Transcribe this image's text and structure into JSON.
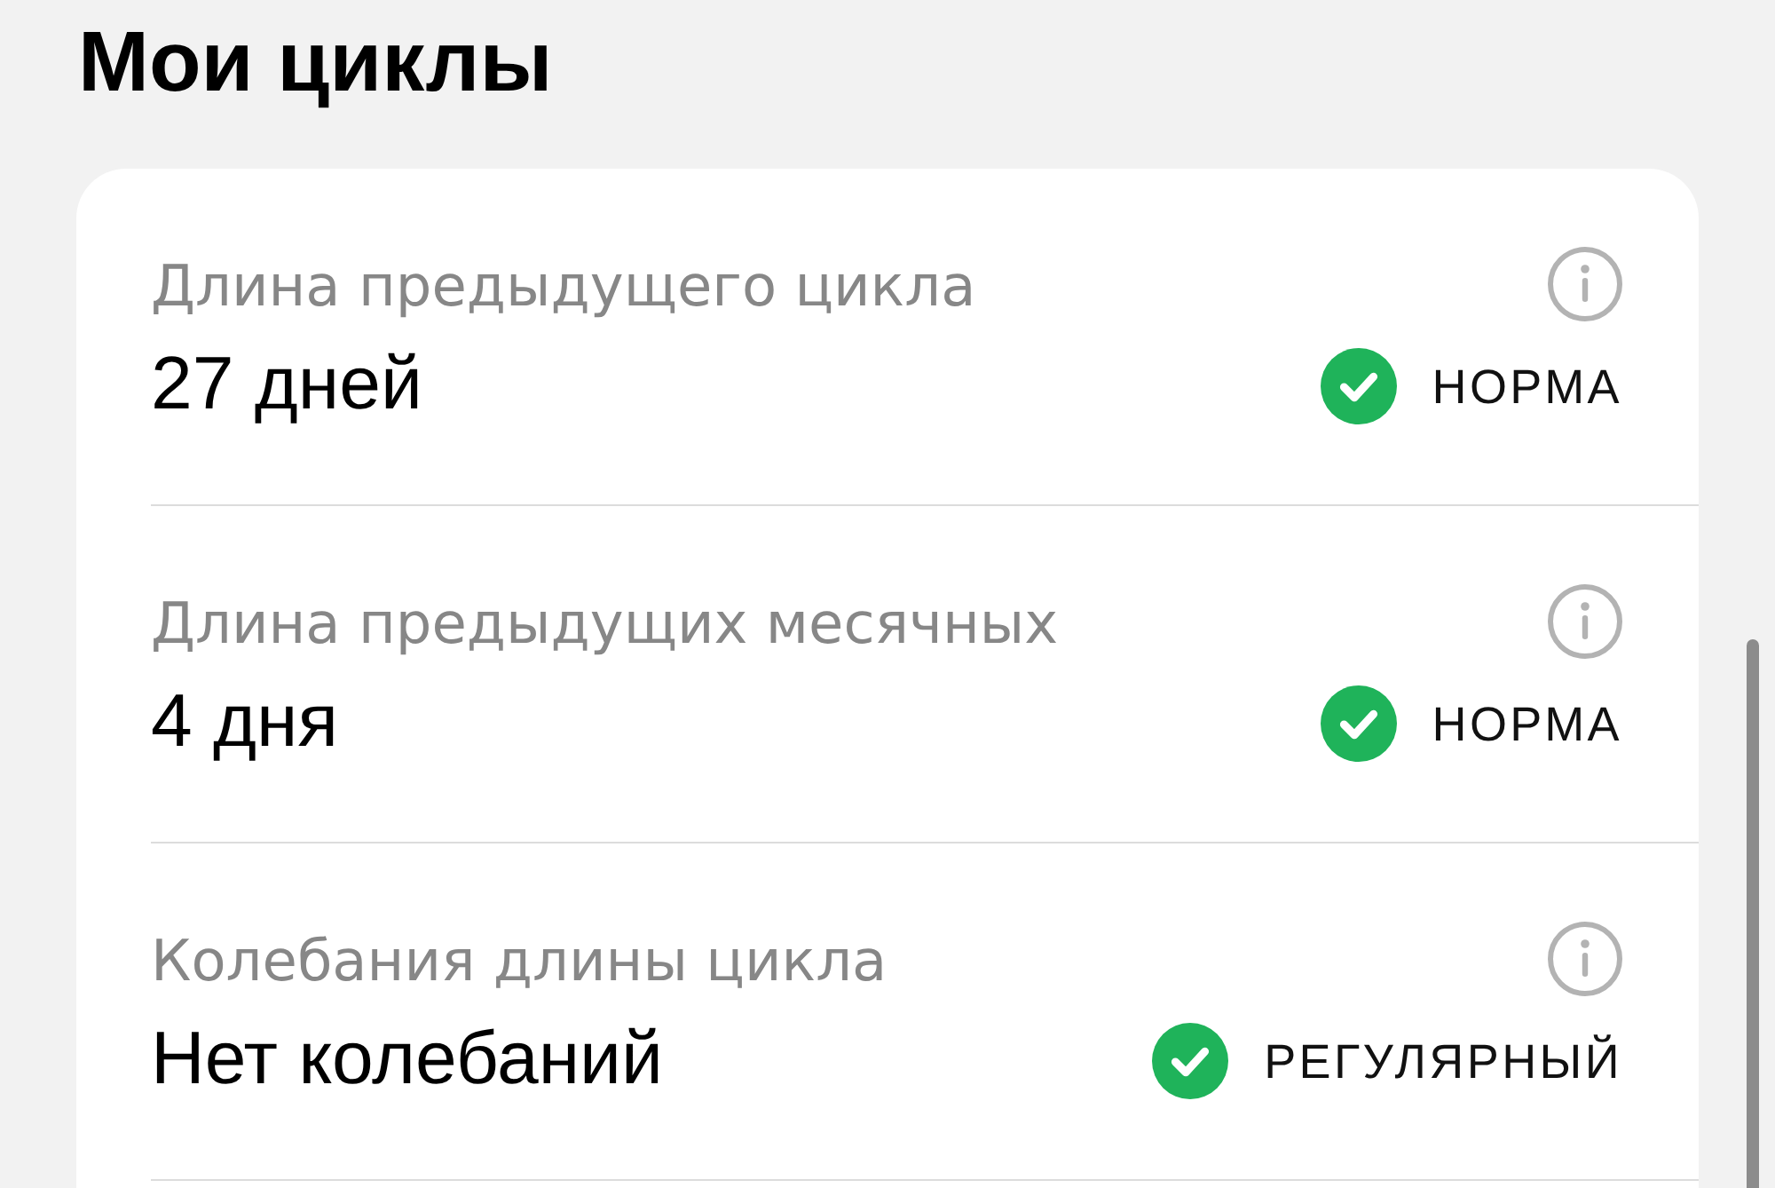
{
  "title": "Мои циклы",
  "metrics": [
    {
      "label": "Длина предыдущего цикла",
      "value": "27 дней",
      "status": "НОРМА",
      "ok": true
    },
    {
      "label": "Длина предыдущих месячных",
      "value": "4 дня",
      "status": "НОРМА",
      "ok": true
    },
    {
      "label": "Колебания длины цикла",
      "value": "Нет колебаний",
      "status": "РЕГУЛЯРНЫЙ",
      "ok": true
    }
  ]
}
